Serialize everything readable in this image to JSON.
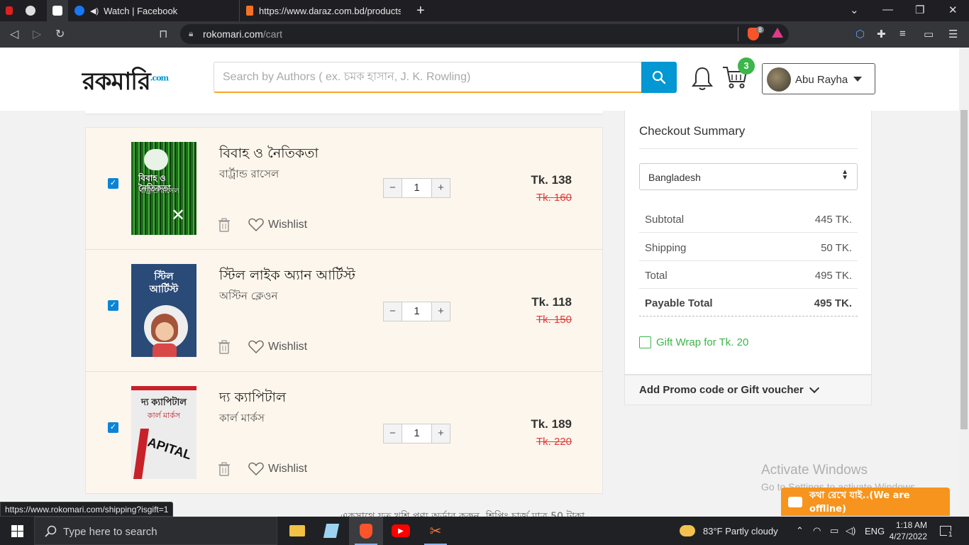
{
  "browser": {
    "tabs": [
      {
        "title": "Watch | Facebook",
        "favicon": "facebook-icon",
        "audio": true
      },
      {
        "title": "https://www.daraz.com.bd/products/h",
        "favicon": "daraz-icon"
      }
    ],
    "url_host": "rokomari.com",
    "url_path": "/cart",
    "brave_badge": "8"
  },
  "header": {
    "logo_text": "রকমারি",
    "logo_suffix": ".com",
    "search_placeholder": "Search by Authors ( ex. চমক হাসান, J. K. Rowling)",
    "cart_count": "3",
    "user_name": "Abu Rayha"
  },
  "cart": {
    "items": [
      {
        "title": "বিবাহ ও নৈতিকতা",
        "author": "বার্ট্রান্ড রাসেল",
        "qty": "1",
        "price": "Tk. 138",
        "old_price": "Tk. 160",
        "checked": true,
        "cover_text": "বিবাহ ও নৈতিকতা",
        "cover_author": "বার্ট্রান্ড রাসেল"
      },
      {
        "title": "স্টিল লাইক অ্যান আর্টিস্ট",
        "author": "অস্টিন ক্লেওন",
        "qty": "1",
        "price": "Tk. 118",
        "old_price": "Tk. 150",
        "checked": true,
        "cover_text": "স্টিল আর্টিস্ট"
      },
      {
        "title": "দ্য ক্যাপিটাল",
        "author": "কার্ল মার্কস",
        "qty": "1",
        "price": "Tk. 189",
        "old_price": "Tk. 220",
        "checked": true,
        "cover_text": "দ্য ক্যাপিটাল",
        "cover_author": "কার্ল মার্কস",
        "cover_word": "APITAL"
      }
    ],
    "wishlist_label": "Wishlist",
    "minus_label": "−",
    "plus_label": "+",
    "footer_note": "একসাথে যত খুশি পণ্য অর্ডার করুন, শিপিং চার্জ মাত্র 50 টাকা"
  },
  "summary": {
    "title": "Checkout Summary",
    "country": "Bangladesh",
    "rows": [
      {
        "label": "Subtotal",
        "value": "445 TK."
      },
      {
        "label": "Shipping",
        "value": "50 TK."
      },
      {
        "label": "Total",
        "value": "495 TK."
      },
      {
        "label": "Payable Total",
        "value": "495 TK."
      }
    ],
    "gift_wrap": "Gift Wrap for Tk. 20",
    "promo": "Add Promo code or Gift voucher"
  },
  "overlay": {
    "activate_title": "Activate Windows",
    "activate_sub": "Go to Settings to activate Windows.",
    "chat_label": "কথা রেখে যাই..(We are offline)",
    "status_url": "https://www.rokomari.com/shipping?isgift=1"
  },
  "taskbar": {
    "search_placeholder": "Type here to search",
    "weather": "83°F  Partly cloudy",
    "lang": "ENG",
    "time": "1:18 AM",
    "date": "4/27/2022",
    "notif_count": "1"
  },
  "colors": {
    "brand_blue": "#0397d3",
    "accent_orange": "#f7a82a",
    "price_red": "#e23a3a",
    "green": "#3cb54a",
    "chat_orange": "#f7941d"
  }
}
